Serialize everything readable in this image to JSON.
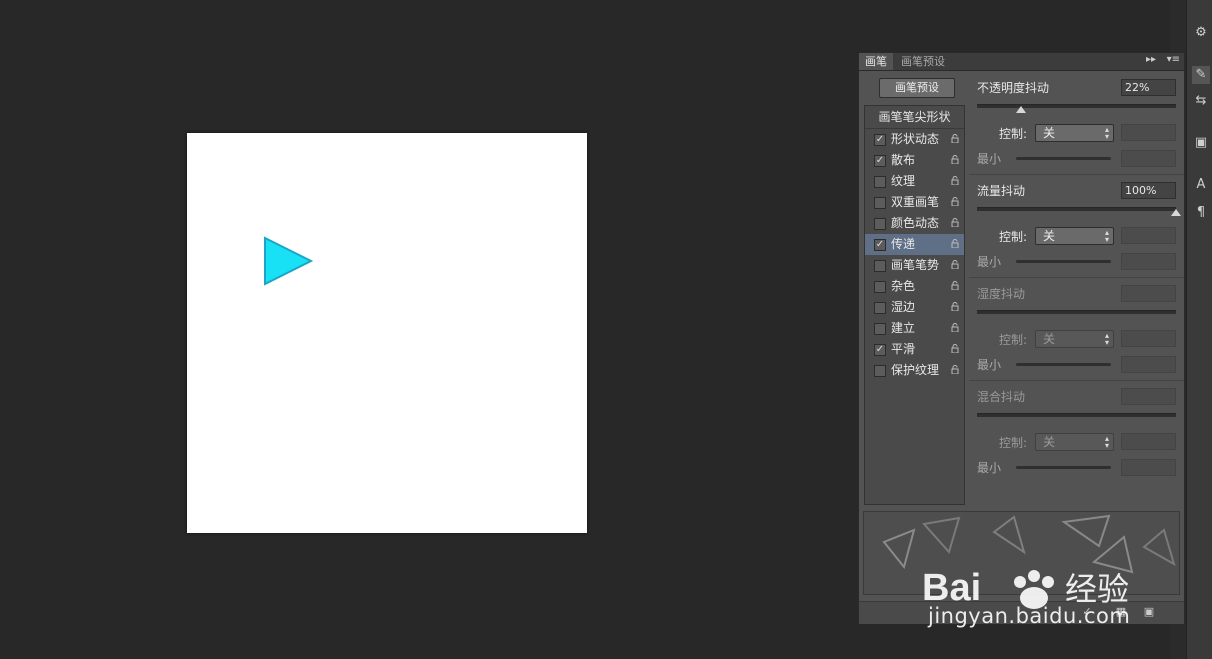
{
  "canvas": {
    "shape_color": "#19e1f5",
    "shape_stroke": "#1aa7c7"
  },
  "panel": {
    "tabs": [
      {
        "label": "画笔",
        "active": true
      },
      {
        "label": "画笔预设",
        "active": false
      }
    ],
    "preset_button": "画笔预设",
    "list_header": "画笔笔尖形状",
    "items": [
      {
        "label": "形状动态",
        "checked": true,
        "selected": false
      },
      {
        "label": "散布",
        "checked": true,
        "selected": false
      },
      {
        "label": "纹理",
        "checked": false,
        "selected": false
      },
      {
        "label": "双重画笔",
        "checked": false,
        "selected": false
      },
      {
        "label": "颜色动态",
        "checked": false,
        "selected": false
      },
      {
        "label": "传递",
        "checked": true,
        "selected": true
      },
      {
        "label": "画笔笔势",
        "checked": false,
        "selected": false
      },
      {
        "label": "杂色",
        "checked": false,
        "selected": false
      },
      {
        "label": "湿边",
        "checked": false,
        "selected": false
      },
      {
        "label": "建立",
        "checked": false,
        "selected": false
      },
      {
        "label": "平滑",
        "checked": true,
        "selected": false
      },
      {
        "label": "保护纹理",
        "checked": false,
        "selected": false
      }
    ],
    "sections": [
      {
        "title": "不透明度抖动",
        "value": "22%",
        "slider_fraction": 0.22,
        "control_label": "控制:",
        "control_value": "关",
        "min_label": "最小",
        "enabled": true
      },
      {
        "title": "流量抖动",
        "value": "100%",
        "slider_fraction": 1.0,
        "control_label": "控制:",
        "control_value": "关",
        "min_label": "最小",
        "enabled": true
      },
      {
        "title": "湿度抖动",
        "value": "",
        "slider_fraction": null,
        "control_label": "控制:",
        "control_value": "关",
        "min_label": "最小",
        "enabled": false
      },
      {
        "title": "混合抖动",
        "value": "",
        "slider_fraction": null,
        "control_label": "控制:",
        "control_value": "关",
        "min_label": "最小",
        "enabled": false
      }
    ]
  },
  "toolbar_icons": [
    "brush-settings-icon",
    "brush-icon",
    "clone-source-icon",
    "stamp-icon",
    "character-icon",
    "paragraph-icon"
  ],
  "watermark": {
    "brand": "Bai du 经验",
    "url": "jingyan.baidu.com"
  }
}
